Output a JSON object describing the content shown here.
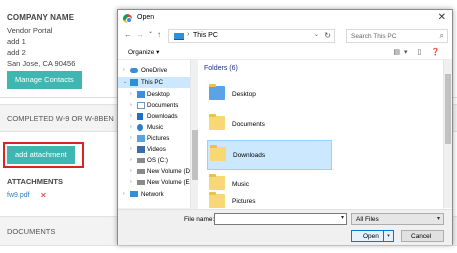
{
  "company": {
    "heading": "COMPANY NAME",
    "lines": [
      "Vendor Portal",
      "add 1",
      "add 2",
      "San Jose, CA 90456"
    ],
    "manage_button": "Manage Contacts"
  },
  "w9_section": {
    "heading": "COMPLETED W-9 OR W-8BEN"
  },
  "add_attachment_button": "add attachment",
  "attachments": {
    "heading": "ATTACHMENTS",
    "file": "fw9.pdf",
    "remove_icon": "✕"
  },
  "documents_section": {
    "heading": "DOCUMENTS"
  },
  "dialog": {
    "title": "Open",
    "close_glyph": "✕",
    "nav": {
      "back": "←",
      "forward": "→",
      "recent": "⌄",
      "up": "↑"
    },
    "address": {
      "separator": "›",
      "location": "This PC",
      "dropdown": "⌄",
      "refresh": "↻"
    },
    "search": {
      "placeholder": "Search This PC",
      "icon": "⌕"
    },
    "toolbar": {
      "organize": "Organize ▾",
      "icons": "▤▾ ▯ ❓"
    },
    "nav_pane": [
      {
        "label": "OneDrive",
        "icon": "cloud-icon",
        "expanded": false
      },
      {
        "label": "This PC",
        "icon": "computer-icon",
        "expanded": true,
        "selected": true
      },
      {
        "label": "Desktop",
        "icon": "desktop-icon",
        "expanded": false
      },
      {
        "label": "Documents",
        "icon": "documents-icon",
        "expanded": false
      },
      {
        "label": "Downloads",
        "icon": "downloads-icon",
        "expanded": false
      },
      {
        "label": "Music",
        "icon": "music-icon",
        "expanded": false
      },
      {
        "label": "Pictures",
        "icon": "pictures-icon",
        "expanded": false
      },
      {
        "label": "Videos",
        "icon": "videos-icon",
        "expanded": false
      },
      {
        "label": "OS (C:)",
        "icon": "drive-icon",
        "expanded": false
      },
      {
        "label": "New Volume (D:)",
        "icon": "drive-icon",
        "expanded": false
      },
      {
        "label": "New Volume (E:)",
        "icon": "drive-icon",
        "expanded": false
      },
      {
        "label": "Network",
        "icon": "network-icon",
        "expanded": false
      }
    ],
    "folders_heading": "Folders (6)",
    "folders": [
      {
        "label": "Desktop",
        "selected": false
      },
      {
        "label": "Documents",
        "selected": false
      },
      {
        "label": "Downloads",
        "selected": true
      },
      {
        "label": "Music",
        "selected": false
      },
      {
        "label": "Pictures",
        "selected": false
      }
    ],
    "file_name_label": "File name:",
    "file_name_value": "",
    "file_type": "All Files",
    "dropdown_glyph": "▾",
    "open_button": "Open",
    "cancel_button": "Cancel"
  },
  "colors": {
    "accent_teal": "#3fb6b2",
    "highlight_red": "#d22222",
    "selection_blue": "#cce8ff",
    "link_blue": "#2a7fc1"
  }
}
